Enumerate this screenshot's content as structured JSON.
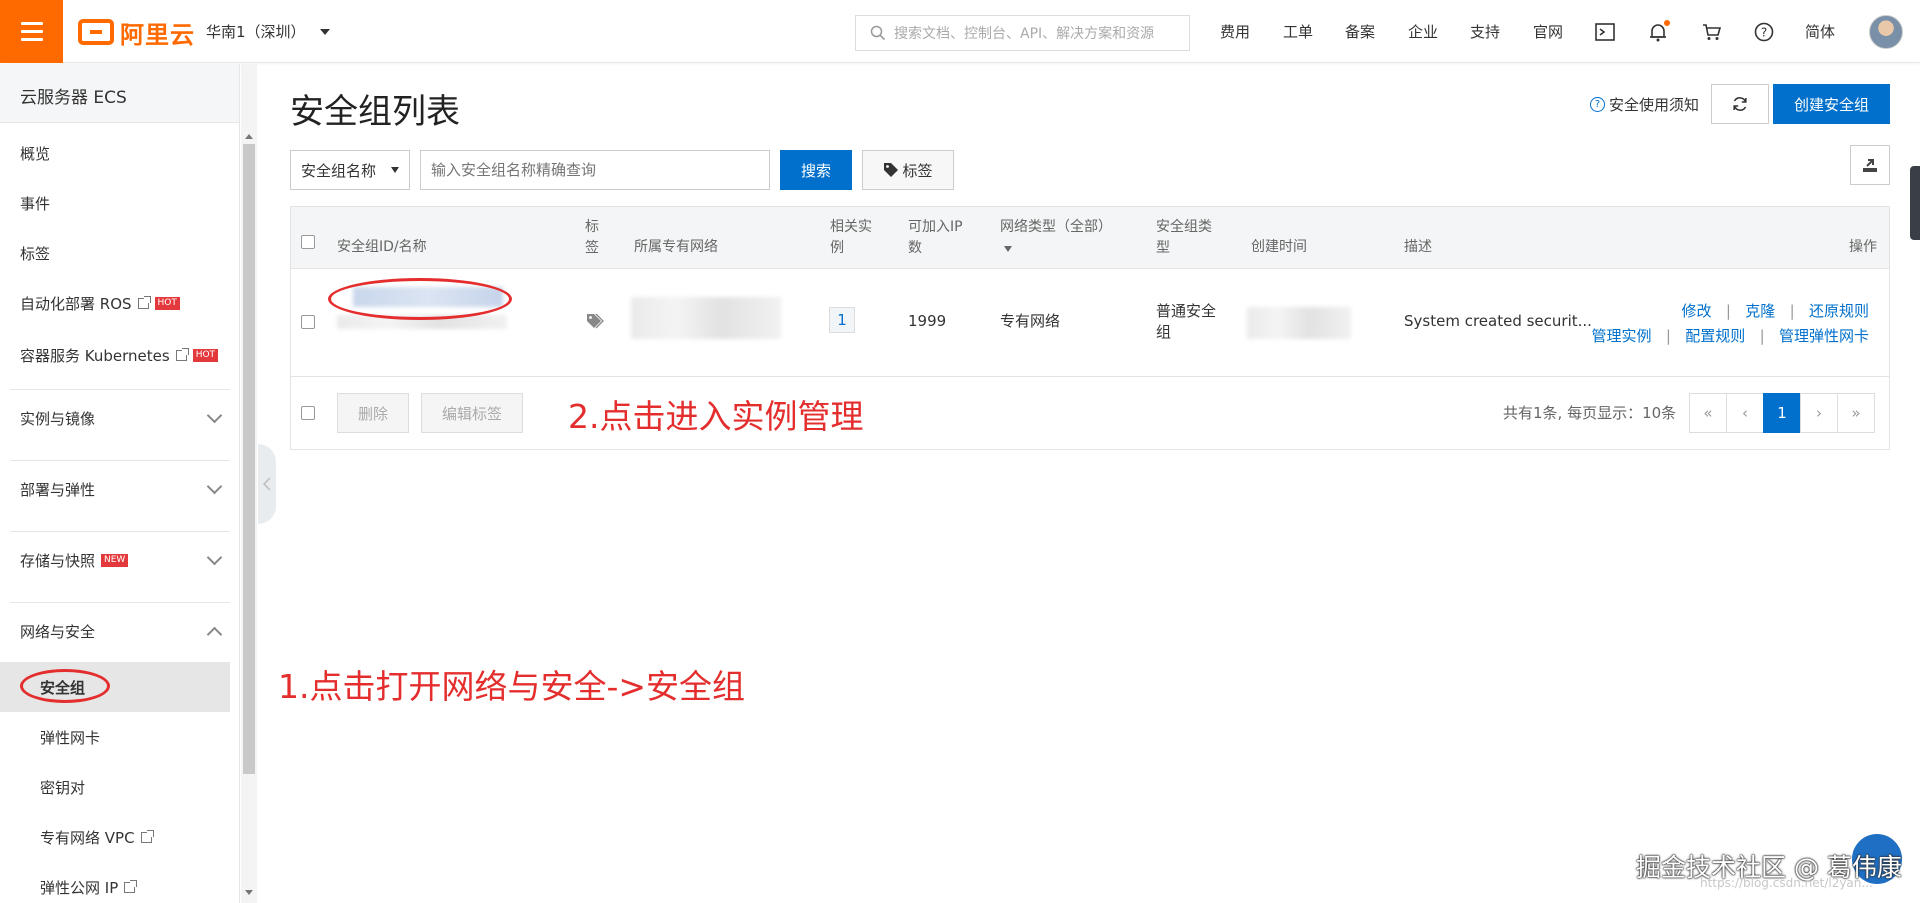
{
  "topbar": {
    "logo_text": "阿里云",
    "region": "华南1（深圳）",
    "search_placeholder": "搜索文档、控制台、API、解决方案和资源",
    "nav": [
      "费用",
      "工单",
      "备案",
      "企业",
      "支持",
      "官网"
    ],
    "language": "简体",
    "icons": [
      "terminal-icon",
      "bell-icon",
      "cart-icon",
      "help-icon"
    ],
    "accent_color": "#ff6a00"
  },
  "sidebar": {
    "title": "云服务器 ECS",
    "top_items": [
      {
        "label": "概览"
      },
      {
        "label": "事件"
      },
      {
        "label": "标签"
      },
      {
        "label": "自动化部署 ROS",
        "badge": "HOT"
      },
      {
        "label": "容器服务 Kubernetes",
        "badge": "HOT"
      }
    ],
    "groups": [
      {
        "label": "实例与镜像"
      },
      {
        "label": "部署与弹性"
      },
      {
        "label": "存储与快照",
        "badge": "NEW"
      },
      {
        "label": "网络与安全"
      }
    ],
    "network_items": [
      {
        "label": "安全组"
      },
      {
        "label": "弹性网卡"
      },
      {
        "label": "密钥对"
      },
      {
        "label": "专有网络 VPC"
      },
      {
        "label": "弹性公网 IP"
      }
    ]
  },
  "main": {
    "title": "安全组列表",
    "help_link": "安全使用须知",
    "create_button": "创建安全组",
    "filter": {
      "select_value": "安全组名称",
      "input_placeholder": "输入安全组名称精确查询",
      "search_button": "搜索",
      "tag_button": "标签"
    },
    "table": {
      "headers": {
        "id_name": "安全组ID/名称",
        "tag_l1": "标",
        "tag_l2": "签",
        "vpc": "所属专有网络",
        "instances_l1": "相关实",
        "instances_l2": "例",
        "ip_l1": "可加入IP",
        "ip_l2": "数",
        "network_type": "网络类型（全部）",
        "sg_type_l1": "安全组类",
        "sg_type_l2": "型",
        "created": "创建时间",
        "description": "描述",
        "actions": "操作"
      },
      "row": {
        "instances": "1",
        "ip_available": "1999",
        "network_type": "专有网络",
        "sg_type_l1": "普通安全",
        "sg_type_l2": "组",
        "description": "System created securit...",
        "actions_row1": [
          "修改",
          "克隆",
          "还原规则"
        ],
        "actions_row2": [
          "管理实例",
          "配置规则",
          "管理弹性网卡"
        ]
      },
      "footer": {
        "delete_button": "删除",
        "edit_tags_button": "编辑标签",
        "summary": "共有1条, 每页显示：10条",
        "pager": [
          "«",
          "‹",
          "1",
          "›",
          "»"
        ]
      }
    }
  },
  "annotations": {
    "step1": "1.点击打开网络与安全->安全组",
    "step2": "2.点击进入实例管理",
    "color": "#e42e2e"
  },
  "watermark": {
    "text": "掘金技术社区 @ 葛伟康",
    "url": "https://blog.csdn.net/l2yan..."
  }
}
